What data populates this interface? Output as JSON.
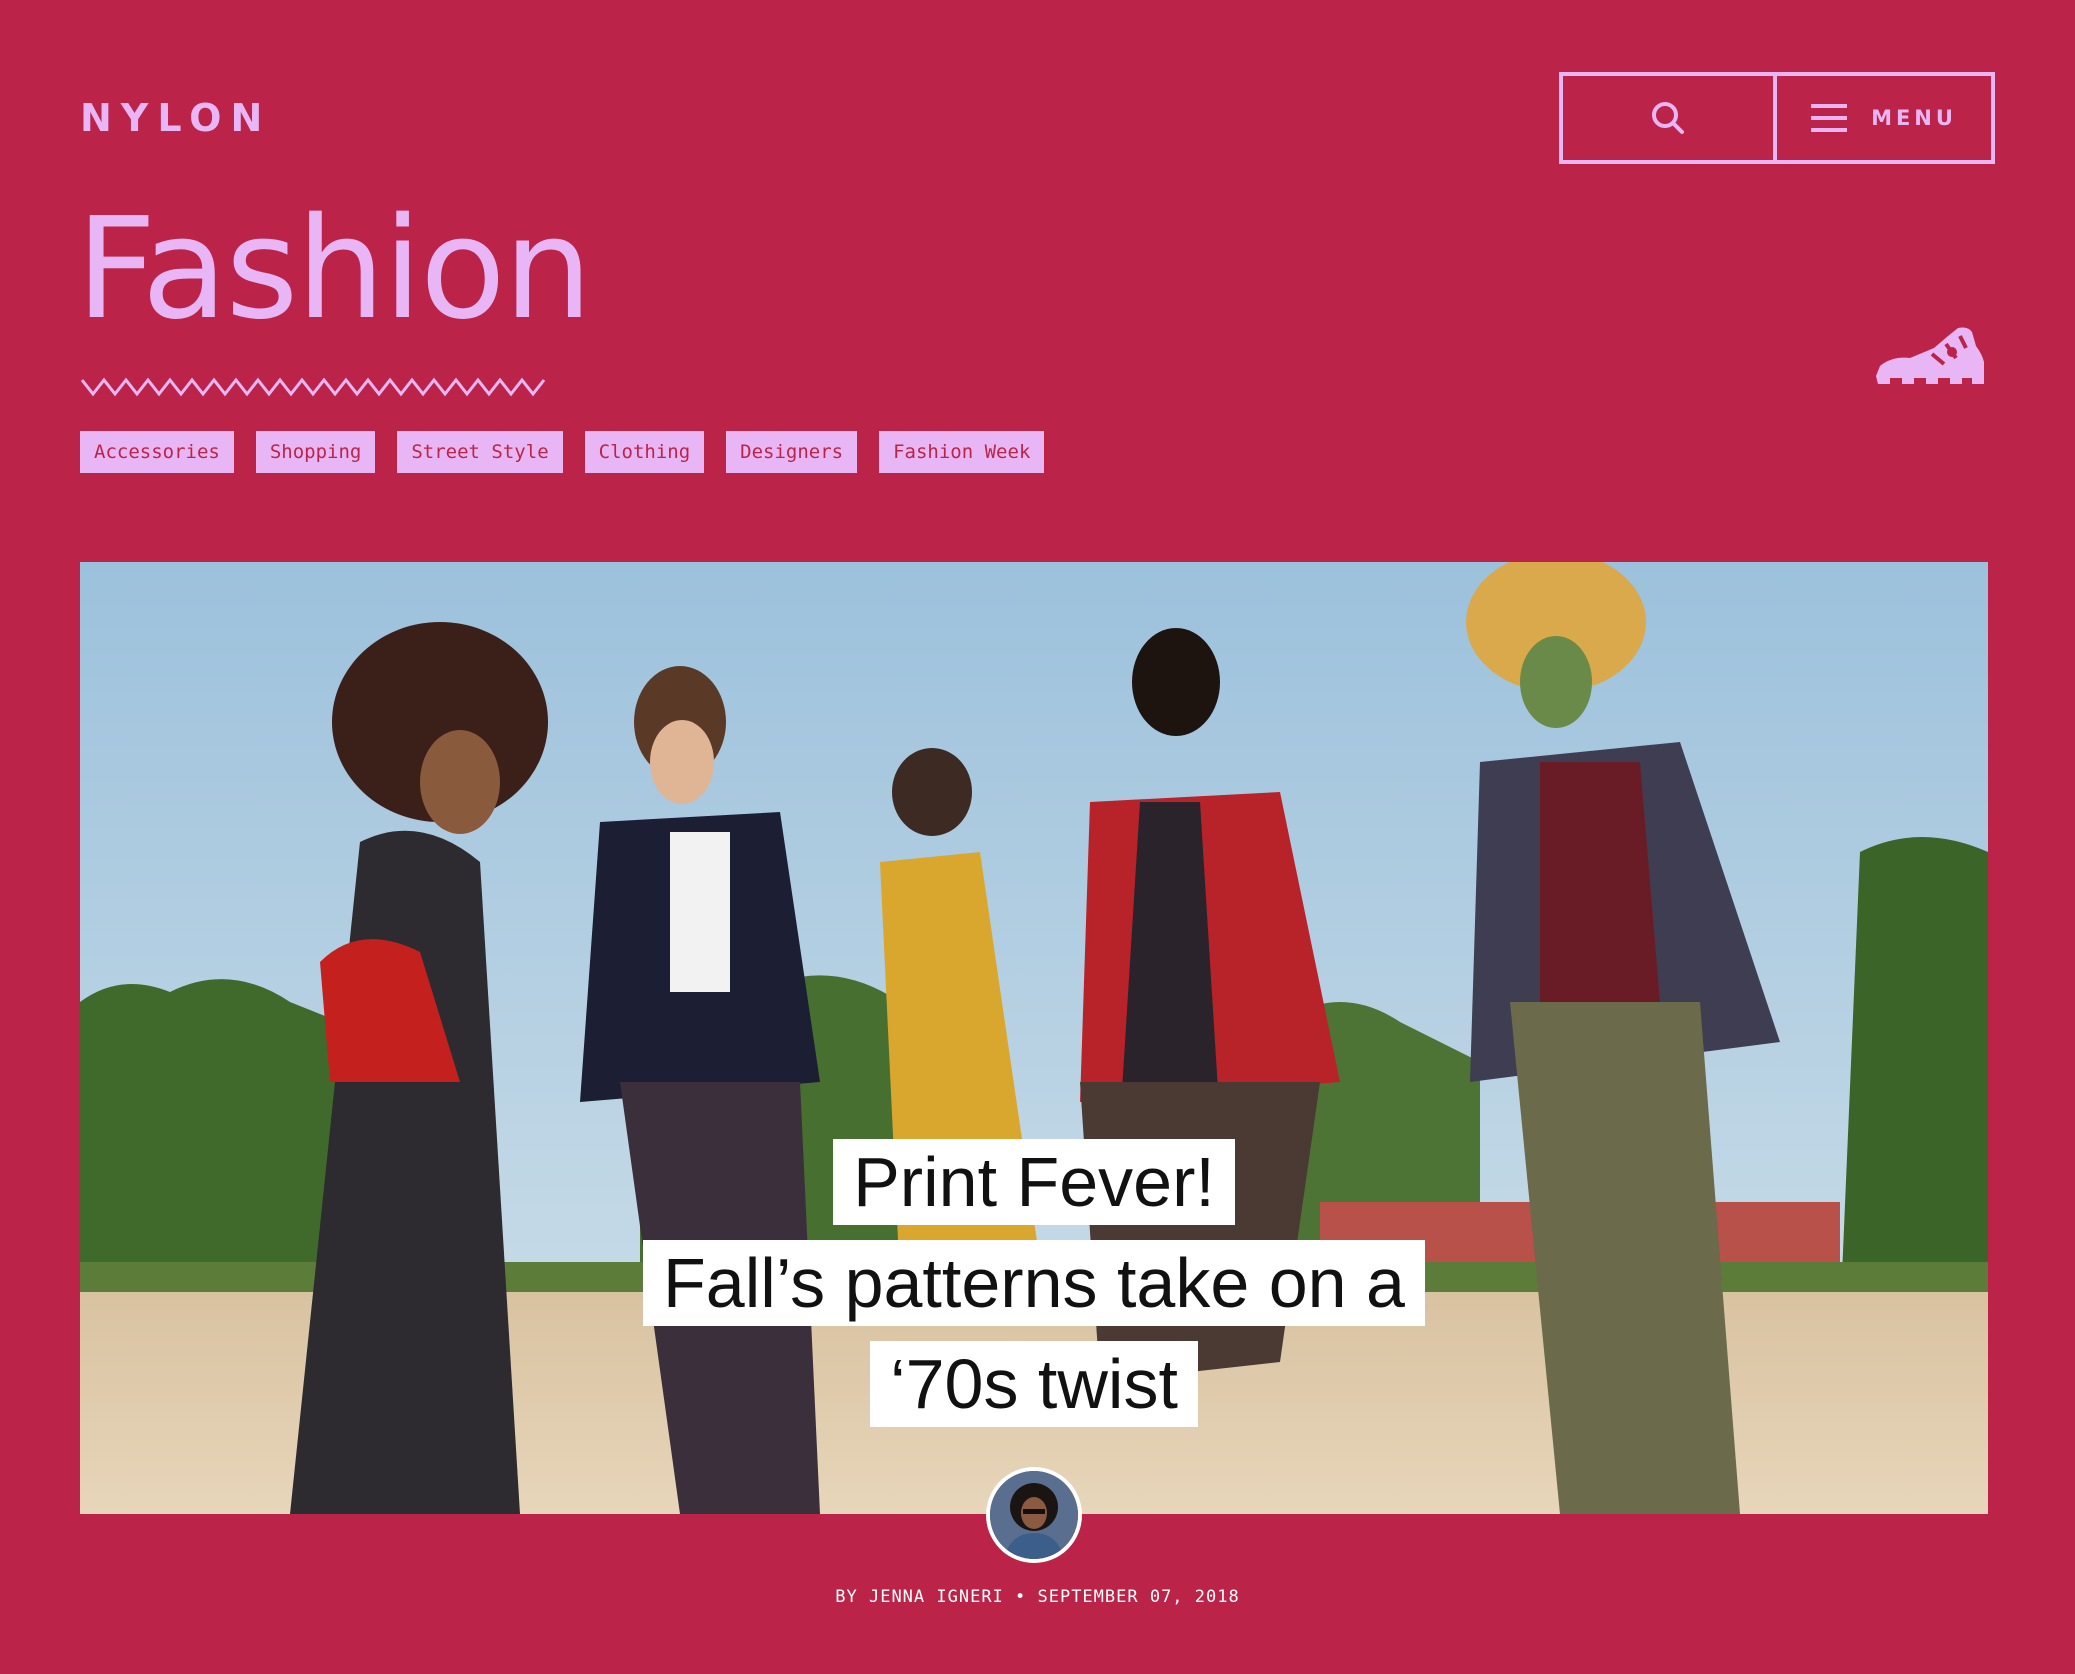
{
  "header": {
    "logo": "NYLON",
    "search_icon": "search-icon",
    "menu_icon": "hamburger-icon",
    "menu_label": "MENU"
  },
  "page": {
    "title": "Fashion",
    "decoration_icon": "zigzag-underline",
    "category_icon": "sandal-icon"
  },
  "tags": [
    "Accessories",
    "Shopping",
    "Street Style",
    "Clothing",
    "Designers",
    "Fashion Week"
  ],
  "feature": {
    "headline_lines": [
      "Print Fever!",
      "Fall’s patterns take on a",
      "‘70s twist"
    ],
    "byline": "BY JENNA IGNERI • SEPTEMBER 07, 2018"
  },
  "colors": {
    "background": "#bb2448",
    "accent": "#e9b6f5",
    "headline_bg": "#ffffff",
    "headline_text": "#111111"
  }
}
